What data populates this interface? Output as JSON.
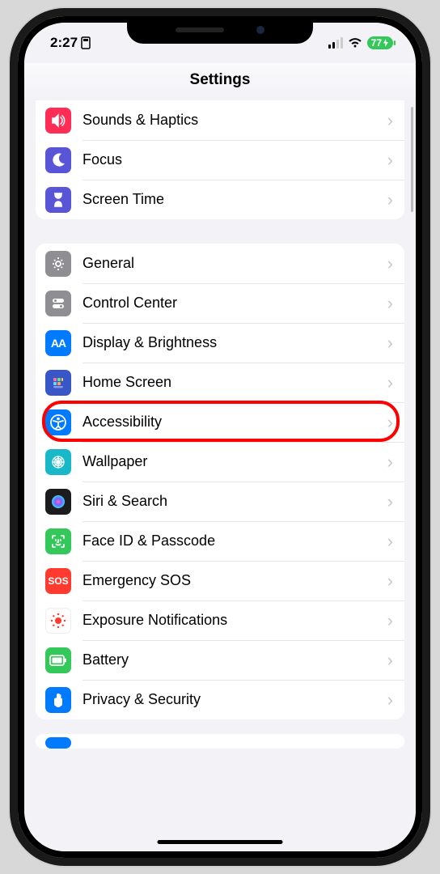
{
  "status": {
    "time": "2:27",
    "battery": "77"
  },
  "header": {
    "title": "Settings"
  },
  "sections": [
    {
      "items": [
        {
          "id": "sounds",
          "label": "Sounds & Haptics",
          "bg": "#ff2d55"
        },
        {
          "id": "focus",
          "label": "Focus",
          "bg": "#5856d6"
        },
        {
          "id": "screen",
          "label": "Screen Time",
          "bg": "#5856d6"
        }
      ]
    },
    {
      "items": [
        {
          "id": "general",
          "label": "General",
          "bg": "#8e8e93"
        },
        {
          "id": "control",
          "label": "Control Center",
          "bg": "#8e8e93"
        },
        {
          "id": "display",
          "label": "Display & Brightness",
          "bg": "#007aff"
        },
        {
          "id": "home",
          "label": "Home Screen",
          "bg": "#3956c9"
        },
        {
          "id": "access",
          "label": "Accessibility",
          "bg": "#007aff",
          "highlight": true
        },
        {
          "id": "wall",
          "label": "Wallpaper",
          "bg": "#19B8C8"
        },
        {
          "id": "siri",
          "label": "Siri & Search",
          "bg": "#1c1c1e"
        },
        {
          "id": "faceid",
          "label": "Face ID & Passcode",
          "bg": "#34c759"
        },
        {
          "id": "sos",
          "label": "Emergency SOS",
          "bg": "#ff3b30"
        },
        {
          "id": "exposure",
          "label": "Exposure Notifications",
          "bg": "#ffffff"
        },
        {
          "id": "battery",
          "label": "Battery",
          "bg": "#34c759"
        },
        {
          "id": "privacy",
          "label": "Privacy & Security",
          "bg": "#007aff"
        }
      ]
    }
  ]
}
